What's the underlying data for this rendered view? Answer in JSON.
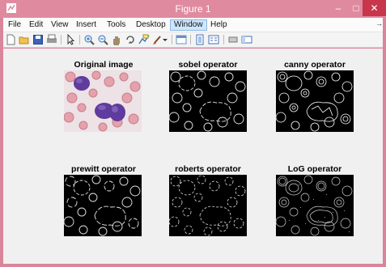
{
  "window": {
    "title": "Figure 1",
    "minimize_glyph": "–",
    "maximize_glyph": "□",
    "close_glyph": "✕",
    "close_color": "#c7364a",
    "titlebar_color": "#e08aa0"
  },
  "menu": {
    "items": [
      "File",
      "Edit",
      "View",
      "Insert",
      "Tools",
      "Desktop",
      "Window",
      "Help"
    ],
    "active": "Window",
    "overflow_glyph": "→"
  },
  "toolbar": {
    "icons": [
      "new-figure-icon",
      "open-file-icon",
      "save-icon",
      "print-icon",
      "pointer-icon",
      "zoom-in-icon",
      "zoom-out-icon",
      "pan-icon",
      "rotate-3d-icon",
      "data-cursor-icon",
      "brush-icon",
      "link-plot-icon",
      "colorbar-icon",
      "legend-icon",
      "hide-plot-tools-icon",
      "show-plot-tools-icon"
    ]
  },
  "panels": [
    {
      "title": "Original image",
      "kind": "photo"
    },
    {
      "title": "sobel operator",
      "kind": "edges"
    },
    {
      "title": "canny operator",
      "kind": "edges"
    },
    {
      "title": "prewitt operator",
      "kind": "edges"
    },
    {
      "title": "roberts operator",
      "kind": "edges"
    },
    {
      "title": "LoG operator",
      "kind": "edges-noisy"
    }
  ]
}
